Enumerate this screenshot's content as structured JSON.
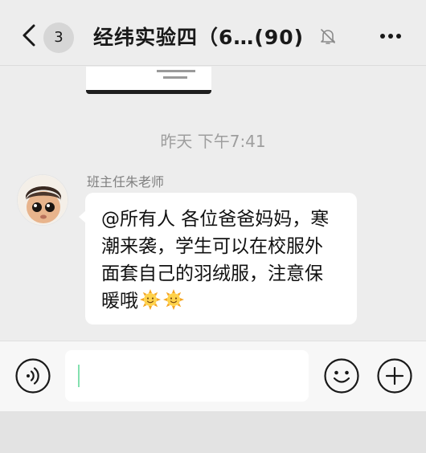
{
  "header": {
    "unread_count": "3",
    "title": "经纬实验四（6…(90)",
    "icons": {
      "back": "chevron-left-icon",
      "mute": "bell-off-icon",
      "more": "more-dots-icon"
    }
  },
  "chat": {
    "timestamp": "昨天 下午7:41",
    "message": {
      "sender": "班主任朱老师",
      "text": "@所有人 各位爸爸妈妈，寒潮来袭，学生可以在校服外面套自己的羽绒服，注意保暖哦",
      "emojis": [
        "sun-emoji",
        "sun-emoji"
      ]
    }
  },
  "input_bar": {
    "value": "",
    "icons": {
      "voice": "voice-icon",
      "emoji": "emoji-icon",
      "add": "plus-icon"
    }
  },
  "colors": {
    "accent": "#07c160",
    "background": "#ededed",
    "bubble": "#ffffff",
    "muted_text": "#9e9e9e"
  }
}
